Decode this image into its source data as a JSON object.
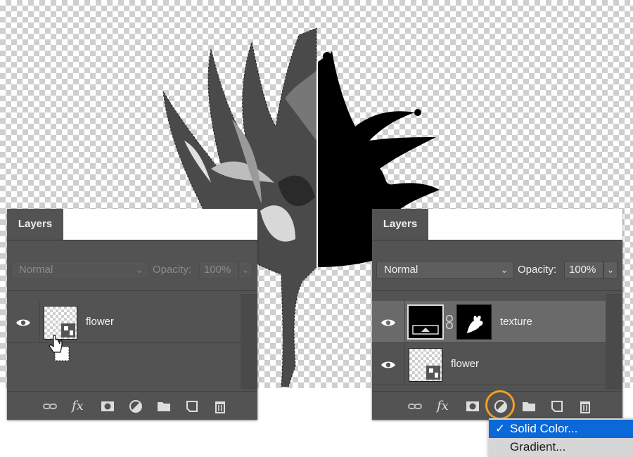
{
  "left_panel": {
    "tab_label": "Layers",
    "blend_mode": "Normal",
    "opacity_label": "Opacity:",
    "opacity_value": "100%",
    "layers": [
      {
        "name": "flower"
      }
    ]
  },
  "right_panel": {
    "tab_label": "Layers",
    "blend_mode": "Normal",
    "opacity_label": "Opacity:",
    "opacity_value": "100%",
    "layers": [
      {
        "name": "texture",
        "selected": true
      },
      {
        "name": "flower",
        "selected": false
      }
    ]
  },
  "footer_icons": [
    "link-icon",
    "fx-icon",
    "mask-icon",
    "adjustment-icon",
    "folder-icon",
    "new-layer-icon",
    "trash-icon"
  ],
  "footer_fx_label": "fx",
  "menu": {
    "items": [
      {
        "label": "Solid Color...",
        "checked": true
      },
      {
        "label": "Gradient...",
        "checked": false
      }
    ]
  },
  "colors": {
    "panel_bg": "#535353",
    "menu_highlight": "#0a68d8",
    "callout_ring": "#f0a020"
  }
}
